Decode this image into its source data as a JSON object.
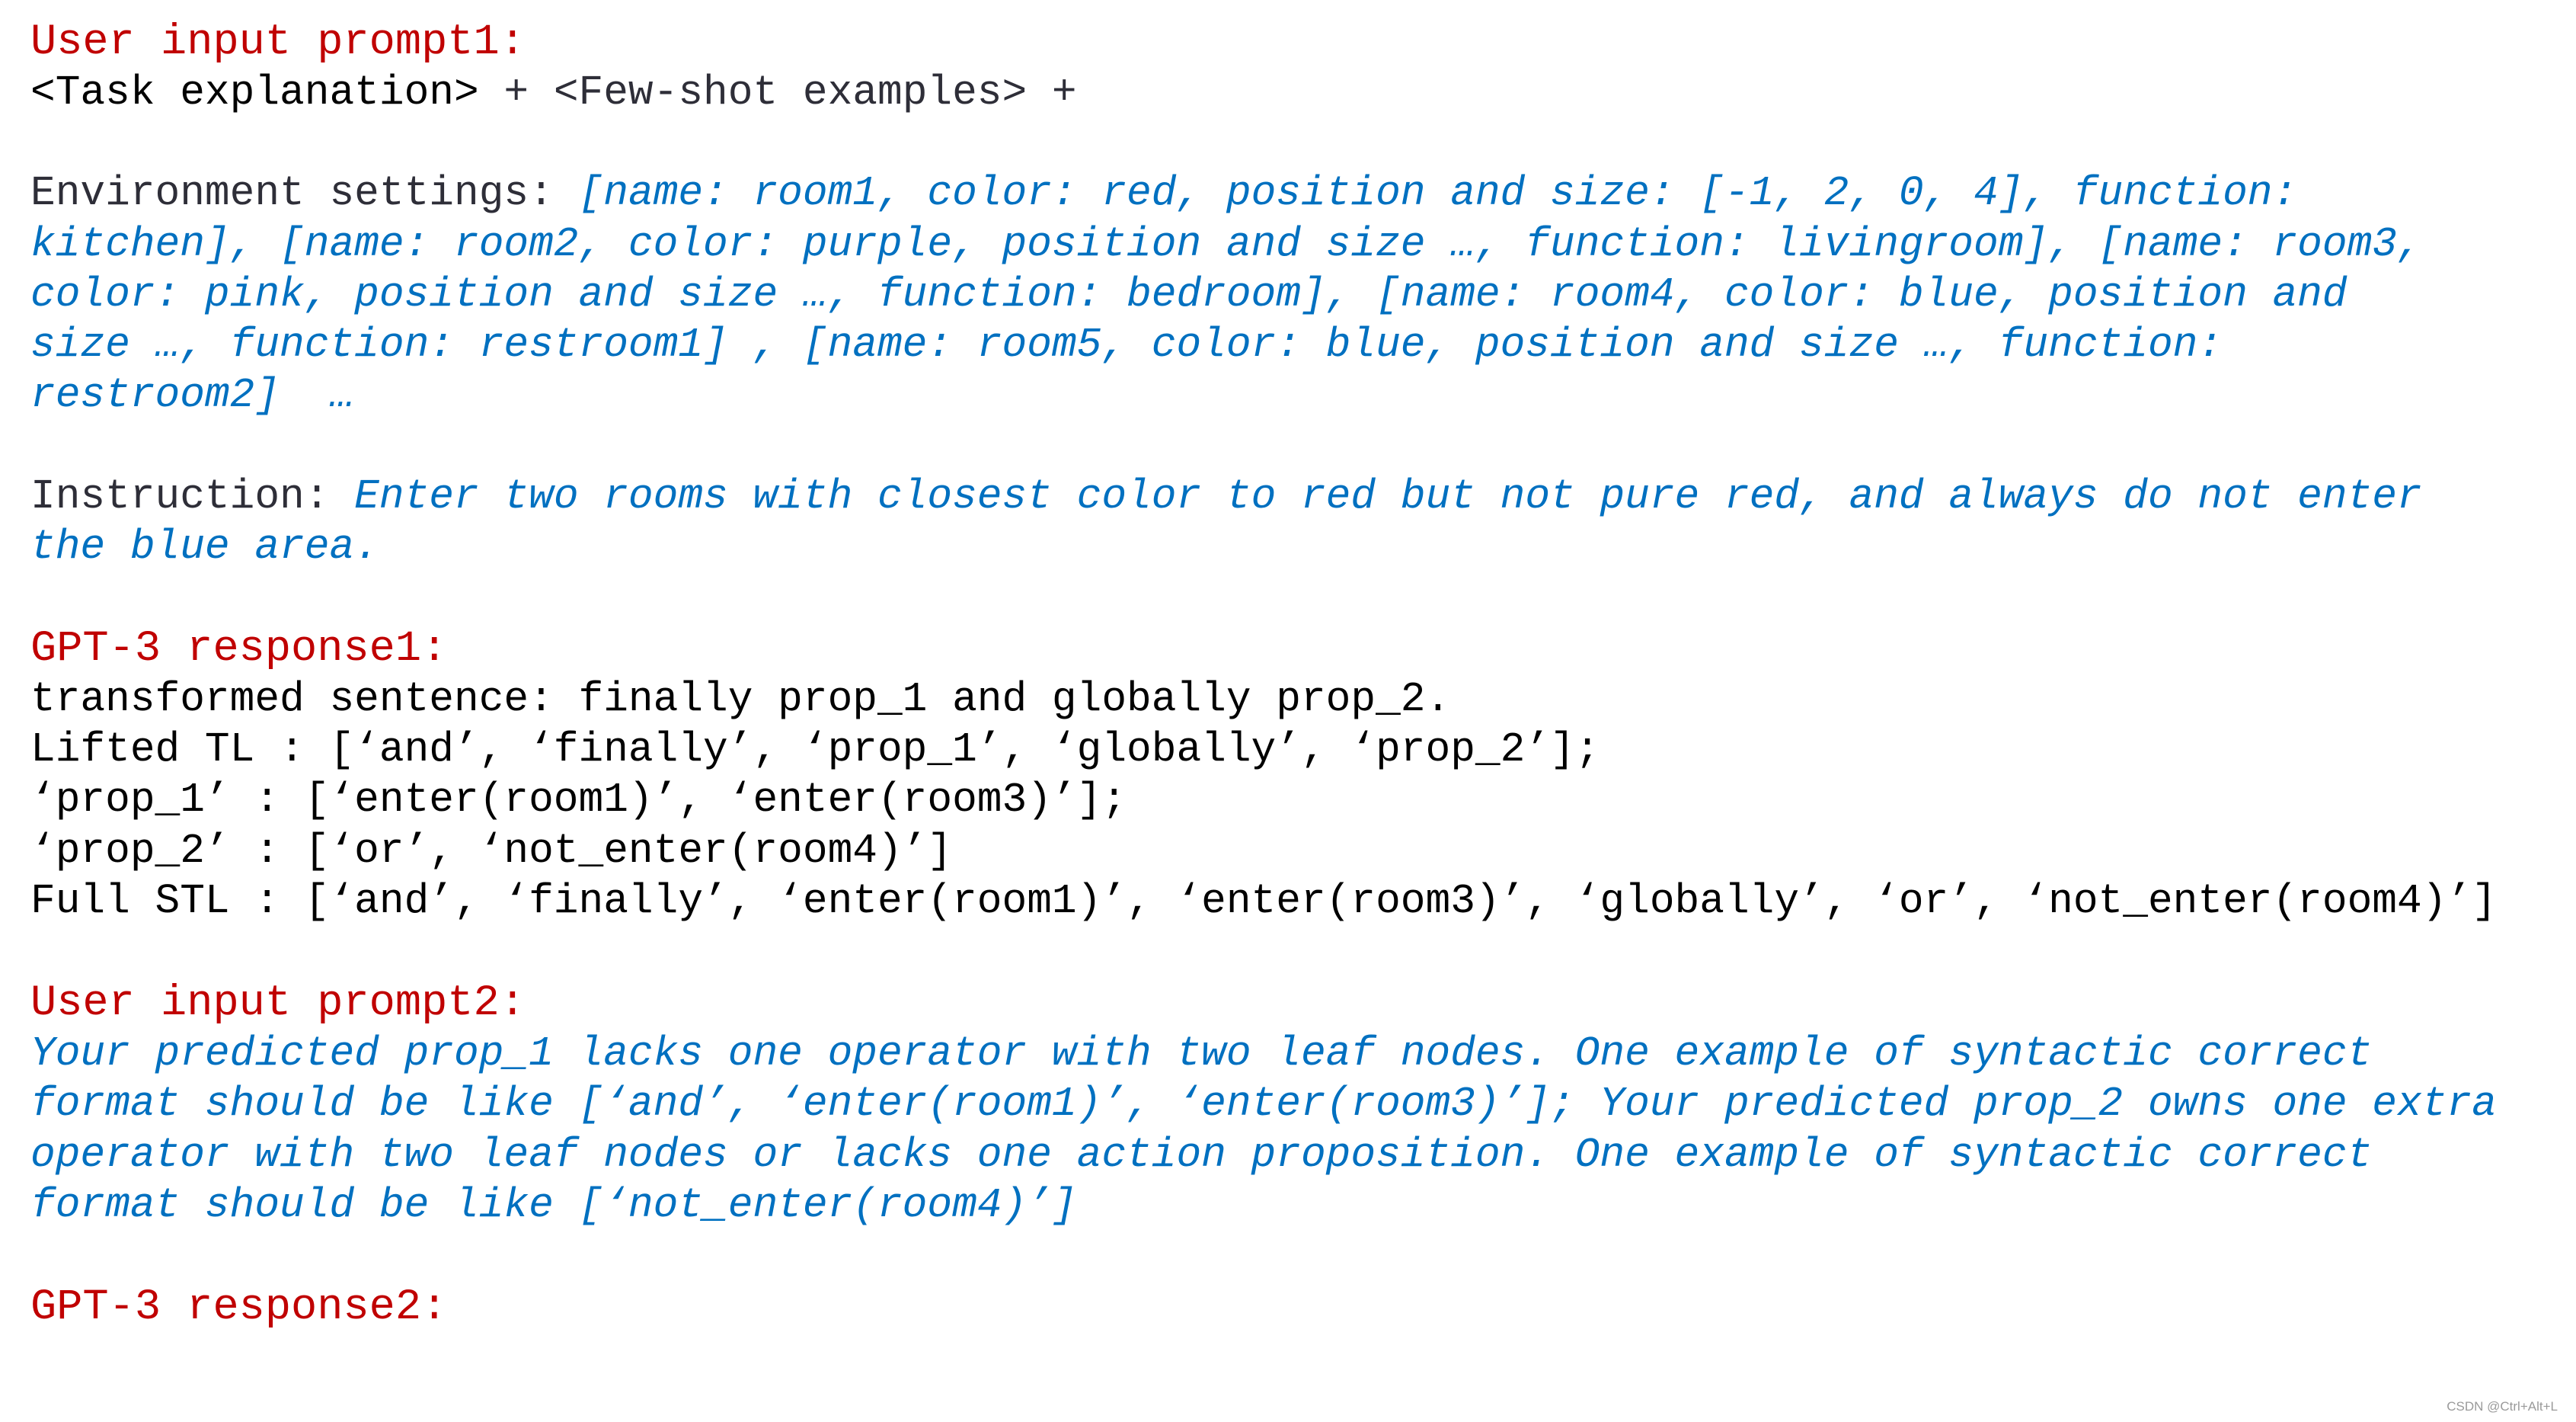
{
  "sections": {
    "prompt1": {
      "heading": "User input prompt1:",
      "intro": {
        "task": "<Task explanation>",
        "rest": " + <Few-shot examples> +"
      },
      "environment": {
        "label": "Environment settings: ",
        "lines": [
          "[name: room1, color: red, position and size: [-1, 2, 0, 4], function:",
          "kitchen], [name: room2, color: purple, position and size …, function: livingroom], [name: room3,",
          "color: pink, position and size …, function: bedroom], [name: room4, color: blue, position and",
          "size …, function: restroom1] , [name: room5, color: blue, position and size …, function:",
          "restroom2]  …"
        ]
      },
      "instruction": {
        "label": "Instruction: ",
        "lines": [
          "Enter two rooms with closest color to red but not pure red, and always do not enter",
          "the blue area."
        ]
      }
    },
    "response1": {
      "heading": "GPT-3 response1:",
      "lines": [
        "transformed sentence: finally prop_1 and globally prop_2.",
        "Lifted TL : [‘and’, ‘finally’, ‘prop_1’, ‘globally’, ‘prop_2’];",
        "‘prop_1’ : [‘enter(room1)’, ‘enter(room3)’];",
        "‘prop_2’ : [‘or’, ‘not_enter(room4)’]",
        "Full STL : [‘and’, ‘finally’, ‘enter(room1)’, ‘enter(room3)’, ‘globally’, ‘or’, ‘not_enter(room4)’]"
      ]
    },
    "prompt2": {
      "heading": "User input prompt2:",
      "lines": [
        "Your predicted prop_1 lacks one operator with two leaf nodes. One example of syntactic correct",
        "format should be like [‘and’, ‘enter(room1)’, ‘enter(room3)’]; Your predicted prop_2 owns one extra",
        "operator with two leaf nodes or lacks one action proposition. One example of syntactic correct",
        "format should be like [‘not_enter(room4)’]"
      ]
    },
    "response2": {
      "heading": "GPT-3 response2:"
    }
  },
  "watermark": "CSDN @Ctrl+Alt+L",
  "colors": {
    "heading": "#C00000",
    "user_content": "#0070C0",
    "label": "#2E2E38",
    "response": "#000000"
  }
}
